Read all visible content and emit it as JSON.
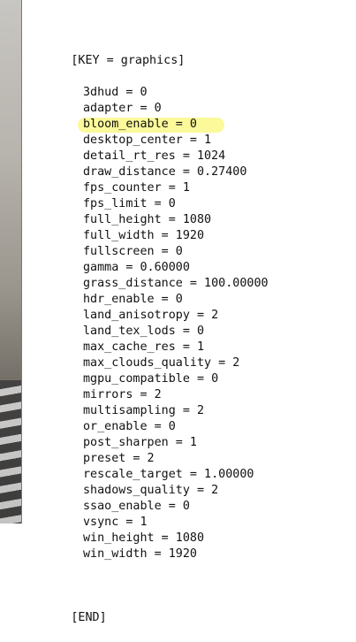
{
  "section_header": "[KEY = graphics]",
  "settings": [
    {
      "text": "3dhud = 0"
    },
    {
      "text": "adapter = 0"
    },
    {
      "text": "bloom_enable = 0",
      "highlighted": true
    },
    {
      "text": "desktop_center = 1"
    },
    {
      "text": "detail_rt_res = 1024"
    },
    {
      "text": "draw_distance = 0.27400"
    },
    {
      "text": "fps_counter = 1"
    },
    {
      "text": "fps_limit = 0"
    },
    {
      "text": "full_height = 1080"
    },
    {
      "text": "full_width = 1920"
    },
    {
      "text": "fullscreen = 0"
    },
    {
      "text": "gamma = 0.60000"
    },
    {
      "text": "grass_distance = 100.00000"
    },
    {
      "text": "hdr_enable = 0"
    },
    {
      "text": "land_anisotropy = 2"
    },
    {
      "text": "land_tex_lods = 0"
    },
    {
      "text": "max_cache_res = 1"
    },
    {
      "text": "max_clouds_quality = 2"
    },
    {
      "text": "mgpu_compatible = 0"
    },
    {
      "text": "mirrors = 2"
    },
    {
      "text": "multisampling = 2"
    },
    {
      "text": "or_enable = 0"
    },
    {
      "text": "post_sharpen = 1"
    },
    {
      "text": "preset = 2"
    },
    {
      "text": "rescale_target = 1.00000"
    },
    {
      "text": "shadows_quality = 2"
    },
    {
      "text": "ssao_enable = 0"
    },
    {
      "text": "vsync = 1"
    },
    {
      "text": "win_height = 1080"
    },
    {
      "text": "win_width = 1920"
    }
  ],
  "section_footer": "[END]",
  "colors": {
    "text": "#111111",
    "highlight": "#fbf88f",
    "editor_background": "#ffffff"
  }
}
